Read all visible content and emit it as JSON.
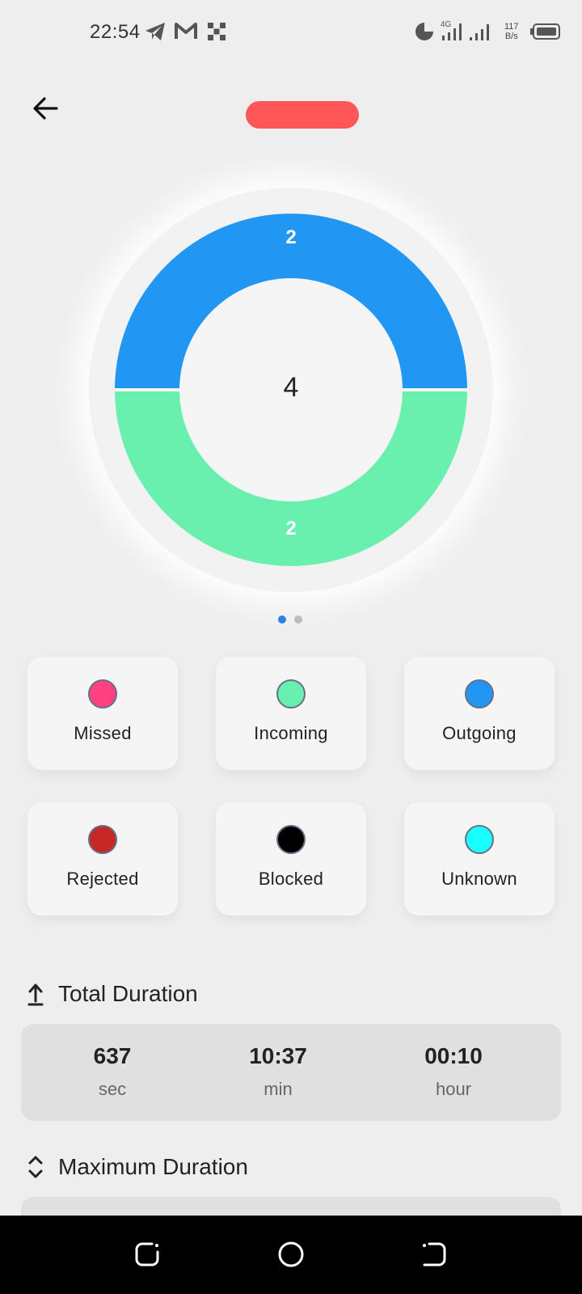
{
  "status_bar": {
    "time": "22:54",
    "net_speed_value": "117",
    "net_speed_unit": "B/s",
    "network_type": "4G",
    "icons": [
      "telegram-icon",
      "gmail-icon",
      "app-grid-icon",
      "data-saver-icon",
      "signal-icon",
      "battery-icon"
    ]
  },
  "header": {
    "back_icon": "arrow-left-icon"
  },
  "chart_data": {
    "type": "pie",
    "total": "4",
    "segments": [
      {
        "label": "Outgoing",
        "value": 2,
        "display": "2",
        "color": "#2196f3"
      },
      {
        "label": "Incoming",
        "value": 2,
        "display": "2",
        "color": "#69f0ae"
      }
    ]
  },
  "pager": {
    "count": 2,
    "active": 0
  },
  "legend": [
    {
      "label": "Missed",
      "color": "#ff4081"
    },
    {
      "label": "Incoming",
      "color": "#69f0ae"
    },
    {
      "label": "Outgoing",
      "color": "#2196f3"
    },
    {
      "label": "Rejected",
      "color": "#c62828"
    },
    {
      "label": "Blocked",
      "color": "#000000"
    },
    {
      "label": "Unknown",
      "color": "#18ffff"
    }
  ],
  "total_duration": {
    "title": "Total Duration",
    "icon": "upload-arrow-icon",
    "values": [
      {
        "value": "637",
        "unit": "sec"
      },
      {
        "value": "10:37",
        "unit": "min"
      },
      {
        "value": "00:10",
        "unit": "hour"
      }
    ]
  },
  "maximum_duration": {
    "title": "Maximum Duration",
    "icon": "unfold-icon"
  },
  "nav_bar": {
    "icons": [
      "recent-apps-icon",
      "home-icon",
      "back-icon"
    ]
  }
}
